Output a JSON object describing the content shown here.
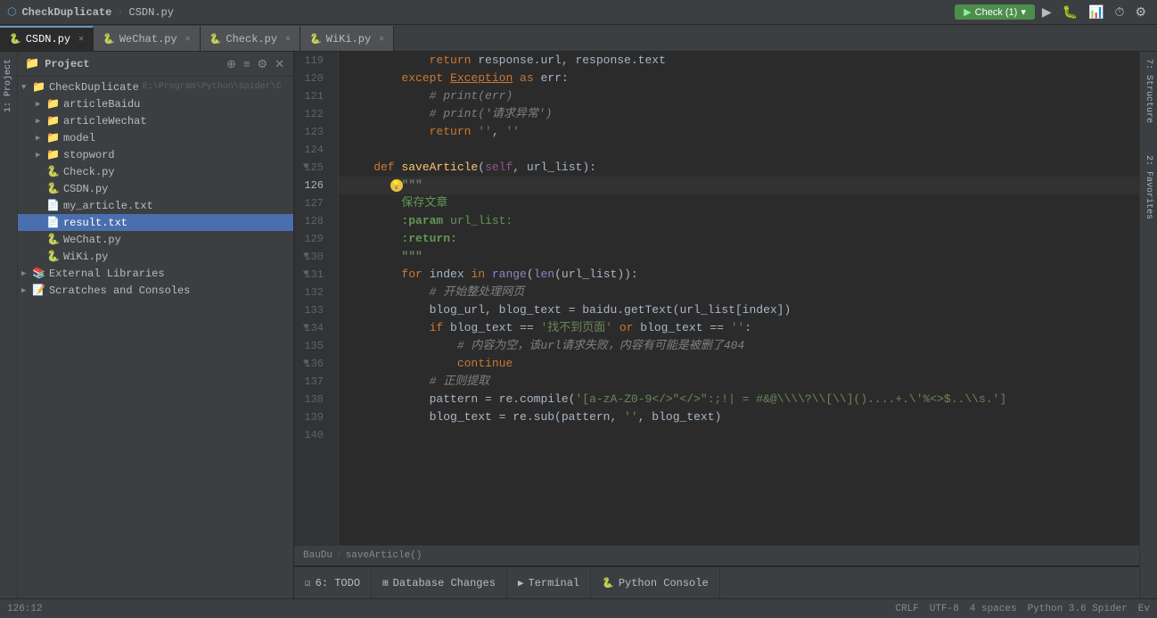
{
  "titlebar": {
    "project": "CheckDuplicate",
    "file": "CSDN.py",
    "run_label": "Check (1)",
    "run_dropdown": "▾"
  },
  "tabs": [
    {
      "id": "csdn",
      "label": "CSDN.py",
      "icon": "🐍",
      "active": true
    },
    {
      "id": "wechat",
      "label": "WeChat.py",
      "icon": "🐍",
      "active": false
    },
    {
      "id": "check",
      "label": "Check.py",
      "icon": "🐍",
      "active": false
    },
    {
      "id": "wiki",
      "label": "WiKi.py",
      "icon": "🐍",
      "active": false
    }
  ],
  "sidebar": {
    "title": "Project",
    "root": "CheckDuplicate",
    "root_path": "E:\\Program\\Python\\Spider\\C",
    "items": [
      {
        "id": "articleBaidu",
        "label": "articleBaidu",
        "type": "folder",
        "indent": 1,
        "expanded": false
      },
      {
        "id": "articleWechat",
        "label": "articleWechat",
        "type": "folder",
        "indent": 1,
        "expanded": false
      },
      {
        "id": "model",
        "label": "model",
        "type": "folder",
        "indent": 1,
        "expanded": false
      },
      {
        "id": "stopword",
        "label": "stopword",
        "type": "folder",
        "indent": 1,
        "expanded": false
      },
      {
        "id": "checkpy",
        "label": "Check.py",
        "type": "file-py",
        "indent": 1
      },
      {
        "id": "csdnpy",
        "label": "CSDN.py",
        "type": "file-py",
        "indent": 1
      },
      {
        "id": "myarticle",
        "label": "my_article.txt",
        "type": "file-txt",
        "indent": 1
      },
      {
        "id": "resulttxt",
        "label": "result.txt",
        "type": "file-txt",
        "indent": 1,
        "selected": true
      },
      {
        "id": "wechatpy",
        "label": "WeChat.py",
        "type": "file-py",
        "indent": 1
      },
      {
        "id": "wikipy",
        "label": "WiKi.py",
        "type": "file-py",
        "indent": 1
      },
      {
        "id": "extlibs",
        "label": "External Libraries",
        "type": "folder-special",
        "indent": 0,
        "expanded": false
      },
      {
        "id": "scratches",
        "label": "Scratches and Consoles",
        "type": "folder-special",
        "indent": 0,
        "expanded": false
      }
    ]
  },
  "editor": {
    "lines": [
      {
        "num": 119,
        "content": "            return response.url, response.text",
        "type": "code"
      },
      {
        "num": 120,
        "content": "        except Exception as err:",
        "type": "code"
      },
      {
        "num": 121,
        "content": "            # print(err)",
        "type": "code"
      },
      {
        "num": 122,
        "content": "            # print('请求异常')",
        "type": "code"
      },
      {
        "num": 123,
        "content": "            return '', ''",
        "type": "code"
      },
      {
        "num": 124,
        "content": "",
        "type": "blank"
      },
      {
        "num": 125,
        "content": "    def saveArticle(self, url_list):",
        "type": "code",
        "fold": true
      },
      {
        "num": 126,
        "content": "        \"\"\"",
        "type": "docstring",
        "active": true
      },
      {
        "num": 127,
        "content": "        保存文章",
        "type": "docstring-zh"
      },
      {
        "num": 128,
        "content": "        :param url_list:",
        "type": "docstring-param"
      },
      {
        "num": 129,
        "content": "        :return:",
        "type": "docstring-param"
      },
      {
        "num": 130,
        "content": "        \"\"\"",
        "type": "docstring",
        "fold": true
      },
      {
        "num": 131,
        "content": "        for index in range(len(url_list)):",
        "type": "code",
        "fold": true
      },
      {
        "num": 132,
        "content": "            # 开始整处理网页",
        "type": "code"
      },
      {
        "num": 133,
        "content": "            blog_url, blog_text = baidu.getText(url_list[index])",
        "type": "code"
      },
      {
        "num": 134,
        "content": "            if blog_text == '找不到页面' or blog_text == '':",
        "type": "code",
        "fold": true
      },
      {
        "num": 135,
        "content": "                # 内容为空，该url请求失败，内容有可能是被删了404",
        "type": "code"
      },
      {
        "num": 136,
        "content": "                continue",
        "type": "code",
        "fold": true
      },
      {
        "num": 137,
        "content": "            # 正则提取",
        "type": "code"
      },
      {
        "num": 138,
        "content": "            pattern = re.compile('[a-zA-Z0-9</>\":;!| = #&@\\\\\\\\?\\\\[\\\\]()....+.\\'%<>$..\\\\s.']",
        "type": "code"
      },
      {
        "num": 139,
        "content": "            blog_text = re.sub(pattern, '', blog_text)",
        "type": "code"
      },
      {
        "num": 140,
        "content": "",
        "type": "blank"
      }
    ]
  },
  "breadcrumb": {
    "parts": [
      "BauDu",
      "saveArticle()"
    ]
  },
  "bottom_tabs": [
    {
      "id": "todo",
      "label": "6: TODO",
      "icon": "☑"
    },
    {
      "id": "dbchanges",
      "label": "Database Changes",
      "icon": "⊞"
    },
    {
      "id": "terminal",
      "label": "Terminal",
      "icon": "▶"
    },
    {
      "id": "pyconsole",
      "label": "Python Console",
      "icon": "🐍",
      "active": false
    }
  ],
  "status_bar": {
    "position": "126:12",
    "line_ending": "CRLF",
    "encoding": "UTF-8",
    "indent": "4 spaces",
    "interpreter": "Python 3.6 Spider",
    "event": "Ev"
  }
}
